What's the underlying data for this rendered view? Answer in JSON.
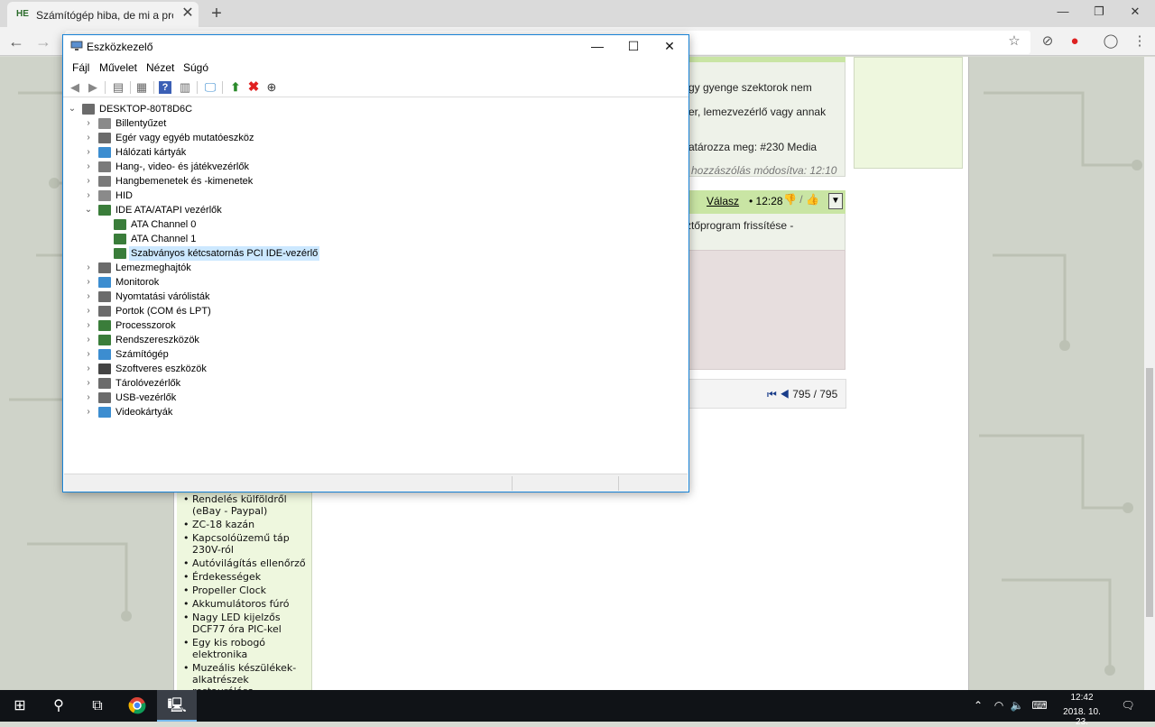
{
  "browser": {
    "tab_title": "Számítógép hiba, de mi a problé",
    "tab_favicon": "HE",
    "new_tab_icon": "+",
    "close_icon": "✕",
    "back_icon": "←",
    "forward_icon": "→"
  },
  "page": {
    "post1_lines": [
      "gy gyenge szektorok nem",
      "er, lemezvezérlő vagy annak",
      "atározza meg: #230 Media"
    ],
    "post1_modified": "hozzászólás módosítva: 12:10",
    "post2_reply": "Válasz",
    "post2_time": "• 12:28",
    "post2_text": "ztőprogram frissítése -",
    "pager": "795 / 795",
    "sidebar_items": [
      "Rendelés külföldről (eBay - Paypal)",
      "ZC-18 kazán",
      "Kapcsolóüzemű táp 230V-ról",
      "Autóvilágítás ellenőrző",
      "Érdekességek",
      "Propeller Clock",
      "Akkumulátoros fúró",
      "Nagy LED kijelzős DCF77 óra PIC-kel",
      "Egy kis robogó elektronika",
      "Muzeális készülékek-alkatrészek restaurálása"
    ]
  },
  "device_manager": {
    "title": "Eszközkezelő",
    "menu": [
      "Fájl",
      "Művelet",
      "Nézet",
      "Súgó"
    ],
    "root": "DESKTOP-80T8D6C",
    "categories": [
      {
        "label": "Billentyűzet",
        "icon": "keyboard-icon",
        "color": "#8a8a8a"
      },
      {
        "label": "Egér vagy egyéb mutatóeszköz",
        "icon": "mouse-icon",
        "color": "#6b6b6b"
      },
      {
        "label": "Hálózati kártyák",
        "icon": "network-icon",
        "color": "#3c8dd0"
      },
      {
        "label": "Hang-, video- és játékvezérlők",
        "icon": "speaker-icon",
        "color": "#7a7a7a"
      },
      {
        "label": "Hangbemenetek és -kimenetek",
        "icon": "speaker-icon",
        "color": "#7a7a7a"
      },
      {
        "label": "HID",
        "icon": "hid-icon",
        "color": "#8a8a8a"
      },
      {
        "label": "IDE ATA/ATAPI vezérlők",
        "icon": "ide-controller-icon",
        "color": "#3a7d3a",
        "expanded": true
      },
      {
        "label": "Lemezmeghajtók",
        "icon": "disk-icon",
        "color": "#6b6b6b"
      },
      {
        "label": "Monitorok",
        "icon": "monitor-icon",
        "color": "#3c8dd0"
      },
      {
        "label": "Nyomtatási várólisták",
        "icon": "printer-icon",
        "color": "#6b6b6b"
      },
      {
        "label": "Portok (COM és LPT)",
        "icon": "port-icon",
        "color": "#6b6b6b"
      },
      {
        "label": "Processzorok",
        "icon": "cpu-icon",
        "color": "#3a7d3a"
      },
      {
        "label": "Rendszereszközök",
        "icon": "system-device-icon",
        "color": "#3a7d3a"
      },
      {
        "label": "Számítógép",
        "icon": "computer-icon",
        "color": "#3c8dd0"
      },
      {
        "label": "Szoftveres eszközök",
        "icon": "software-device-icon",
        "color": "#444444"
      },
      {
        "label": "Tárolóvezérlők",
        "icon": "storage-controller-icon",
        "color": "#6b6b6b"
      },
      {
        "label": "USB-vezérlők",
        "icon": "usb-icon",
        "color": "#6b6b6b"
      },
      {
        "label": "Videokártyák",
        "icon": "display-adapter-icon",
        "color": "#3c8dd0"
      }
    ],
    "ide_children": [
      "ATA Channel 0",
      "ATA Channel 1",
      "Szabványos kétcsatornás PCI IDE-vezérlő"
    ],
    "selected": "Szabványos kétcsatornás PCI IDE-vezérlő"
  },
  "taskbar": {
    "time": "12:42",
    "date": "2018. 10. 23."
  }
}
